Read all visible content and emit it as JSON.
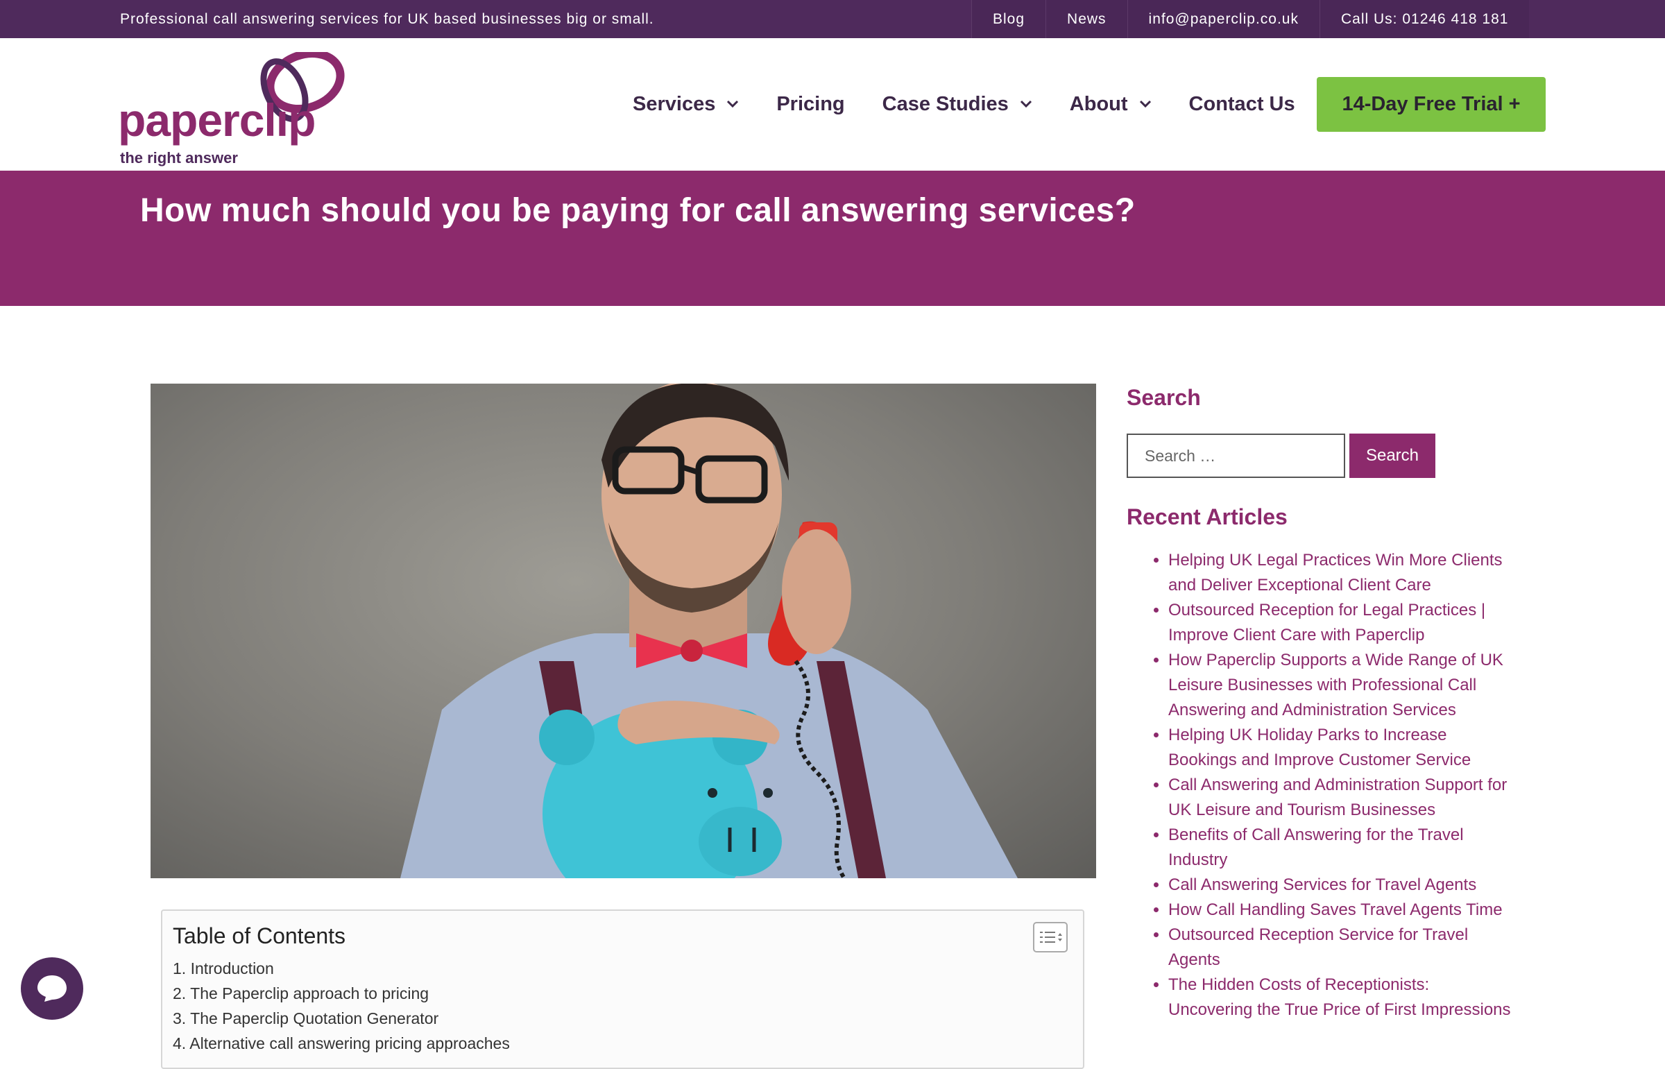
{
  "topbar": {
    "tagline": "Professional call answering services for UK based businesses big or small.",
    "links": {
      "blog": "Blog",
      "news": "News",
      "email": "info@paperclip.co.uk",
      "call": "Call Us: 01246 418 181"
    }
  },
  "logo": {
    "word": "paperclip",
    "tagline": "the right answer"
  },
  "nav": {
    "services": "Services",
    "pricing": "Pricing",
    "case_studies": "Case Studies",
    "about": "About",
    "contact": "Contact Us",
    "trial": "14-Day Free Trial +"
  },
  "hero": {
    "title": "How much should you be paying for call answering services?"
  },
  "toc": {
    "title": "Table of Contents",
    "items": [
      "1. Introduction",
      "2. The Paperclip approach to pricing",
      "3. The Paperclip Quotation Generator",
      "4. Alternative call answering pricing approaches"
    ]
  },
  "sidebar": {
    "search_heading": "Search",
    "search_placeholder": "Search …",
    "search_button": "Search",
    "recent_heading": "Recent Articles",
    "recent": [
      "Helping UK Legal Practices Win More Clients and Deliver Exceptional Client Care",
      "Outsourced Reception for Legal Practices | Improve Client Care with Paperclip",
      "How Paperclip Supports a Wide Range of UK Leisure Businesses with Professional Call Answering and Administration Services",
      "Helping UK Holiday Parks to Increase Bookings and Improve Customer Service",
      "Call Answering and Administration Support for UK Leisure and Tourism Businesses",
      "Benefits of Call Answering for the Travel Industry",
      "Call Answering Services for Travel Agents",
      "How Call Handling Saves Travel Agents Time",
      "Outsourced Reception Service for Travel Agents",
      "The Hidden Costs of Receptionists: Uncovering the True Price of First Impressions"
    ]
  },
  "colors": {
    "topbar": "#4f2a5c",
    "brand": "#8c2a6c",
    "cta": "#7cc242"
  }
}
